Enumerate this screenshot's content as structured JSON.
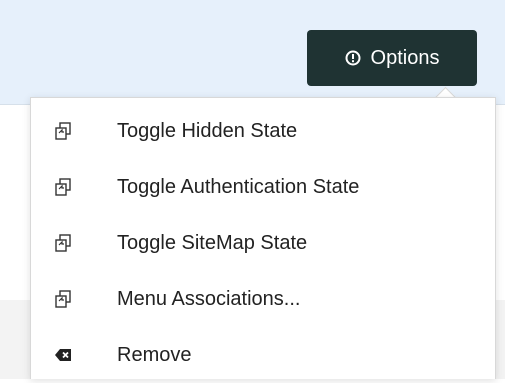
{
  "header": {
    "options_button": {
      "label": "Options",
      "icon": "circle-arrow-down-icon"
    }
  },
  "menu": {
    "items": [
      {
        "label": "Toggle Hidden State",
        "icon": "toggle-copy-icon"
      },
      {
        "label": "Toggle Authentication State",
        "icon": "toggle-copy-icon"
      },
      {
        "label": "Toggle SiteMap State",
        "icon": "toggle-copy-icon"
      },
      {
        "label": "Menu Associations...",
        "icon": "toggle-copy-icon"
      },
      {
        "label": "Remove",
        "icon": "backspace-icon"
      }
    ]
  },
  "colors": {
    "header_background": "#e6f0fb",
    "button_background": "#1f3333",
    "button_text": "#ffffff",
    "menu_text": "#222222"
  }
}
